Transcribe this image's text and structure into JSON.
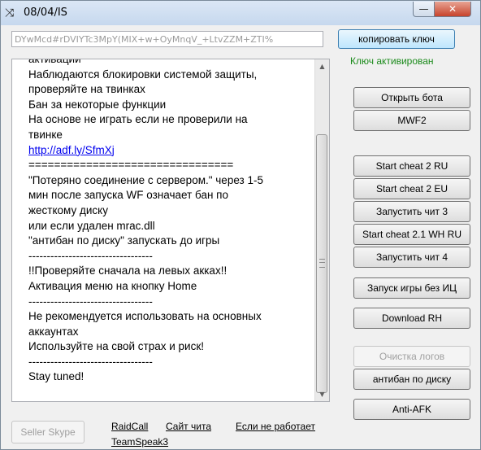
{
  "window": {
    "title": "08/04/IS",
    "min_glyph": "—",
    "close_glyph": "✕",
    "app_icon": "shuffle-icon"
  },
  "key_field": {
    "value": "DYwMcd#rDVIYTc3MpY(MIX+w+OyMnqV_+LtvZZM+ZTI%"
  },
  "buttons": {
    "copy_key": "копировать ключ",
    "open_bot": "Открыть бота",
    "mwf2": "MWF2",
    "start_cheat_2_ru": "Start cheat 2 RU",
    "start_cheat_2_eu": "Start cheat 2 EU",
    "run_cheat_3": "Запустить чит 3",
    "start_cheat_21_wh_ru": "Start cheat 2.1 WH RU",
    "run_cheat_4": "Запустить чит 4",
    "launch_game_no_ic": "Запуск игры без ИЦ",
    "download_rh": "Download RH",
    "clear_logs": "Очистка логов",
    "antiban_disk": "антибан по диску",
    "anti_afk": "Anti-AFK",
    "seller_skype": "Seller Skype"
  },
  "status": {
    "text": "Ключ активирован",
    "color": "#1a8a1a"
  },
  "log": {
    "lines": [
      "активации",
      "Наблюдаются блокировки системой защиты,",
      "проверяйте на твинках",
      "Бан за некоторые функции",
      "На основе не играть если не проверили на",
      "твинке",
      "http://adf.ly/SfmXj",
      "================================",
      "\"Потеряно соединение с сервером.\" через 1-5",
      "мин после запуска WF означает бан по",
      "жесткому диску",
      "или если удален mrac.dll",
      "\"антибан по диску\" запускать до игры",
      "----------------------------------",
      "!!Проверяйте сначала на левых аккаx!!",
      "Активация меню на кнопку Home",
      "----------------------------------",
      "Не рекомендуется использовать на основных",
      "аккаунтах",
      "Используйте на свой страх и риск!",
      "----------------------------------",
      "Stay tuned!"
    ]
  },
  "links": {
    "raidcall": "RaidCall",
    "teamspeak": "TeamSpeak3",
    "cheat_site": "Сайт чита",
    "if_not_working": "Если не работает"
  }
}
